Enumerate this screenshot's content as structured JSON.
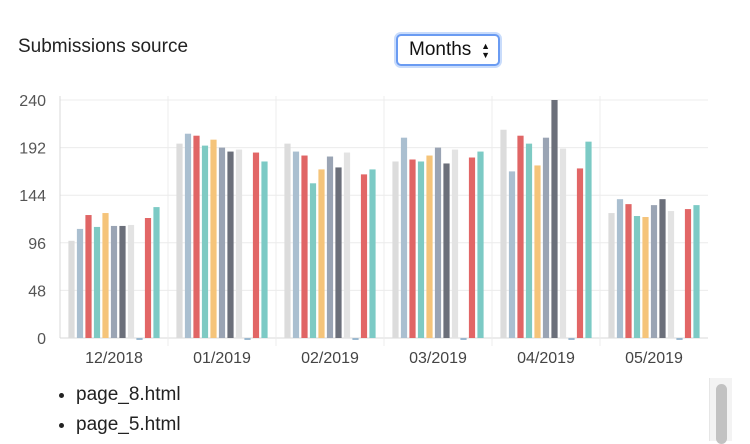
{
  "header": {
    "title": "Submissions source"
  },
  "period_select": {
    "selected": "Months"
  },
  "pages_list": [
    "page_8.html",
    "page_5.html"
  ],
  "colors": [
    "#dcdcdc",
    "#aabfd0",
    "#e06565",
    "#7ecac3",
    "#f5c47a",
    "#9aa4b4",
    "#6b6f7a",
    "#e3e3e3",
    "#9ab8cf",
    "#e26666",
    "#7ccac5"
  ],
  "chart_data": {
    "type": "bar",
    "categories": [
      "12/2018",
      "01/2019",
      "02/2019",
      "03/2019",
      "04/2019",
      "05/2019"
    ],
    "ylim": [
      0,
      240
    ],
    "yticks": [
      0,
      48,
      96,
      144,
      192,
      240
    ],
    "grid": true,
    "series": [
      {
        "values": [
          98,
          196,
          196,
          178,
          210,
          126
        ]
      },
      {
        "values": [
          110,
          206,
          188,
          202,
          168,
          140
        ]
      },
      {
        "values": [
          124,
          204,
          184,
          180,
          204,
          135
        ]
      },
      {
        "values": [
          112,
          194,
          156,
          178,
          196,
          123
        ]
      },
      {
        "values": [
          126,
          200,
          170,
          184,
          174,
          122
        ]
      },
      {
        "values": [
          113,
          192,
          183,
          192,
          202,
          134
        ]
      },
      {
        "values": [
          113,
          188,
          172,
          176,
          240,
          140
        ]
      },
      {
        "values": [
          114,
          190,
          187,
          190,
          191,
          128
        ]
      },
      {
        "values": [
          -2,
          -2,
          -2,
          -2,
          -2,
          -2
        ]
      },
      {
        "values": [
          121,
          187,
          165,
          182,
          171,
          130
        ]
      },
      {
        "values": [
          132,
          178,
          170,
          188,
          198,
          134
        ]
      }
    ]
  }
}
